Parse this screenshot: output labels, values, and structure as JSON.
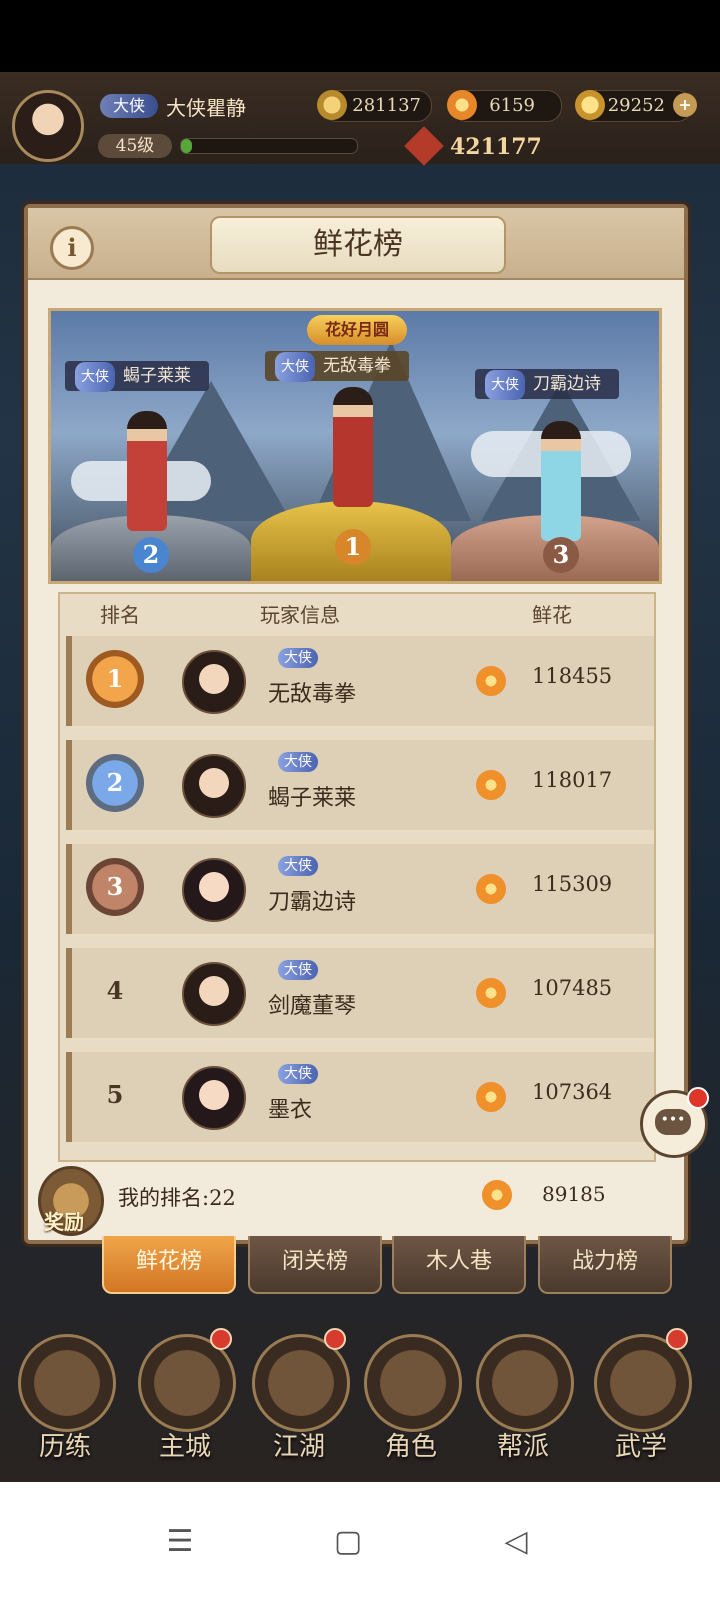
{
  "hud": {
    "title_tag": "大侠",
    "player_name": "大侠瞿静",
    "level": "45级",
    "exp_fraction": 0.06,
    "coins": "281137",
    "flowers": "6159",
    "ingots": "29252",
    "power": "421177"
  },
  "panel": {
    "title": "鲜花榜",
    "info_icon": "info-icon"
  },
  "banner": {
    "logo": "花好月圆",
    "first": {
      "tag": "大侠",
      "name": "无敌毒拳",
      "rank": "1"
    },
    "second": {
      "tag": "大侠",
      "name": "蝎子莱莱",
      "rank": "2"
    },
    "third": {
      "tag": "大侠",
      "name": "刀霸边诗",
      "rank": "3"
    }
  },
  "table": {
    "headers": {
      "rank": "排名",
      "info": "玩家信息",
      "flowers": "鲜花"
    },
    "rows": [
      {
        "rank": "1",
        "tag": "大侠",
        "name": "无敌毒拳",
        "flowers": "118455"
      },
      {
        "rank": "2",
        "tag": "大侠",
        "name": "蝎子莱莱",
        "flowers": "118017"
      },
      {
        "rank": "3",
        "tag": "大侠",
        "name": "刀霸边诗",
        "flowers": "115309"
      },
      {
        "rank": "4",
        "tag": "大侠",
        "name": "剑魔董琴",
        "flowers": "107485"
      },
      {
        "rank": "5",
        "tag": "大侠",
        "name": "墨衣",
        "flowers": "107364"
      }
    ]
  },
  "mine": {
    "reward_label": "奖励",
    "my_rank": "我的排名:22",
    "my_flowers": "89185"
  },
  "tabs": [
    "鲜花榜",
    "闭关榜",
    "木人巷",
    "战力榜"
  ],
  "nav": [
    "历练",
    "主城",
    "江湖",
    "角色",
    "帮派",
    "武学"
  ],
  "chat": {
    "icon": "chat-icon",
    "text": "•••"
  },
  "system_nav": {
    "menu": "☰",
    "home": "▢",
    "back": "◁"
  },
  "colors": {
    "accent": "#e8923a",
    "panel": "#f2ebdc",
    "frame": "#8b6d4c"
  }
}
